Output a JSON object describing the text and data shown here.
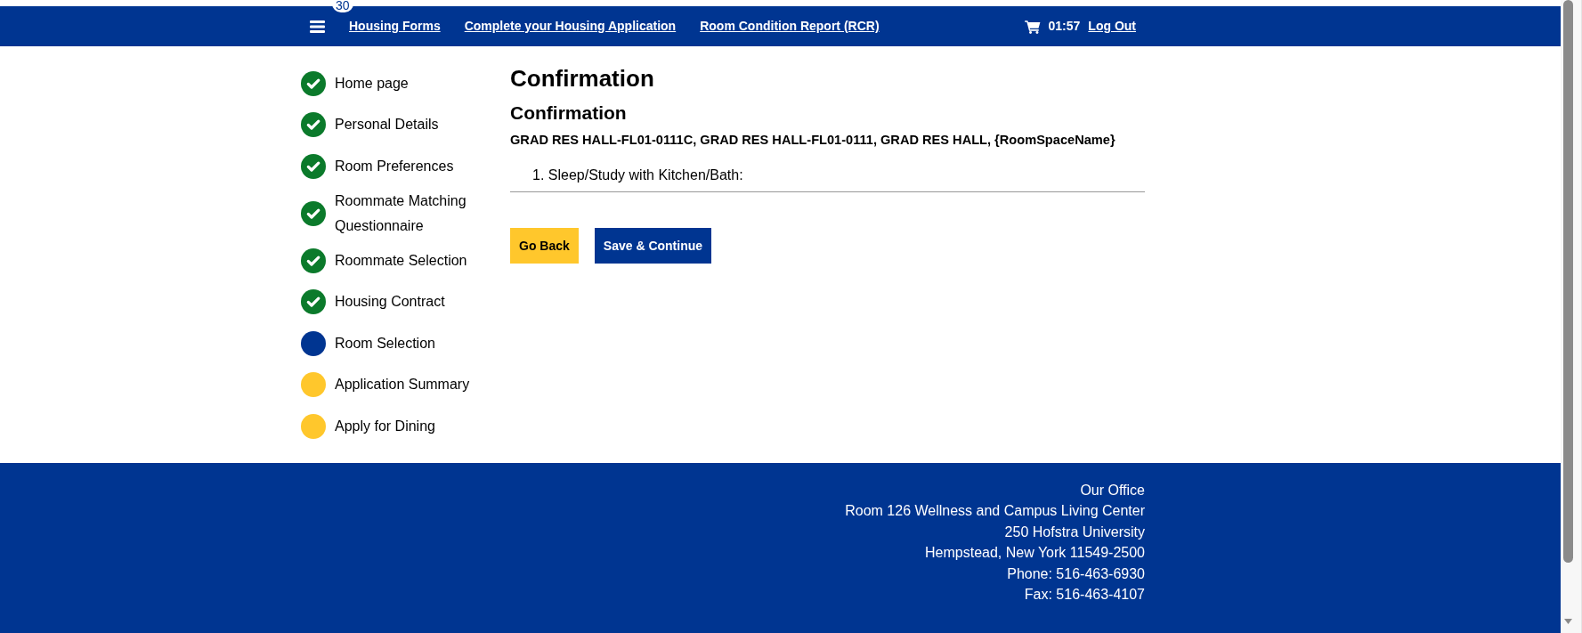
{
  "navbar": {
    "badge": "30",
    "links": [
      {
        "label": "Housing Forms"
      },
      {
        "label": "Complete your Housing Application"
      },
      {
        "label": "Room Condition Report (RCR)"
      }
    ],
    "timer": "01:57",
    "logout": "Log Out"
  },
  "sidebar": {
    "steps": [
      {
        "label": "Home page",
        "completed": true,
        "selected": false
      },
      {
        "label": "Personal Details",
        "completed": true,
        "selected": false
      },
      {
        "label": "Room Preferences",
        "completed": true,
        "selected": false
      },
      {
        "label": "Roommate Matching Questionnaire",
        "completed": true,
        "selected": false
      },
      {
        "label": "Roommate Selection",
        "completed": true,
        "selected": false
      },
      {
        "label": "Housing Contract",
        "completed": true,
        "selected": false
      },
      {
        "label": "Room Selection",
        "completed": false,
        "selected": true
      },
      {
        "label": "Application Summary",
        "completed": false,
        "selected": false
      },
      {
        "label": "Apply for Dining",
        "completed": false,
        "selected": false
      }
    ]
  },
  "main": {
    "title": "Confirmation",
    "subtitle": "Confirmation",
    "room": "GRAD RES HALL-FL01-0111C, GRAD RES HALL-FL01-0111, GRAD RES HALL, {RoomSpaceName}",
    "items": [
      "1. Sleep/Study with Kitchen/Bath:"
    ],
    "buttons": [
      {
        "label": "Go Back",
        "kind": "secondary"
      },
      {
        "label": "Save & Continue",
        "kind": "primary"
      }
    ]
  },
  "footer": {
    "title": "Our Office",
    "lines": [
      "Room 126 Wellness and Campus Living Center",
      "250 Hofstra University",
      "Hempstead, New York 11549-2500",
      "Phone: 516-463-6930",
      "Fax: 516-463-4107"
    ]
  }
}
